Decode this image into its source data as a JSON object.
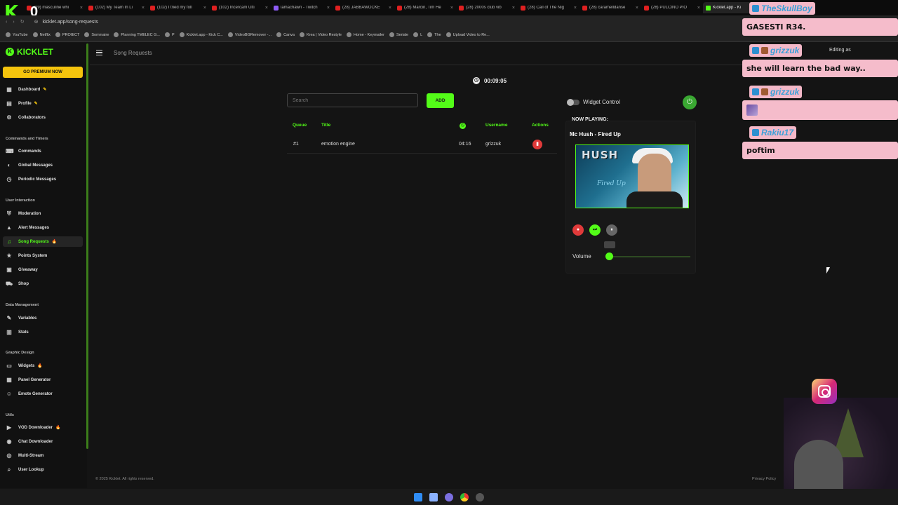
{
  "browser": {
    "tabs": [
      {
        "label": "(29) masculine whi",
        "type": "yt"
      },
      {
        "label": "(102) My Team In Li",
        "type": "yt"
      },
      {
        "label": "(102) I tried my foll",
        "type": "yt"
      },
      {
        "label": "(102) Încercăm Ulti",
        "type": "yt"
      },
      {
        "label": "lamachawn - Twitch",
        "type": "twitch"
      },
      {
        "label": "(28) JABBAWOCKE",
        "type": "yt"
      },
      {
        "label": "(28) Marcin, Tim He",
        "type": "yt"
      },
      {
        "label": "(28) 2000s club vib",
        "type": "yt"
      },
      {
        "label": "(28) Call of The Nig",
        "type": "yt"
      },
      {
        "label": "(28) caramelldanse",
        "type": "yt"
      },
      {
        "label": "(28) PULCINO PIO",
        "type": "yt"
      },
      {
        "label": "Kicklet.app - Ki",
        "type": "kick"
      }
    ],
    "url": "kicklet.app/song-requests",
    "bookmarks": [
      "YouTube",
      "Netflix",
      "PROIECT",
      "Sommaire",
      "Planning TMELEC G...",
      "P",
      "Kicklet.app - Kick C...",
      "VideoBGRemover -...",
      "Canva",
      "Krea | Video Restyle",
      "Home - Keymailer",
      "Seriale",
      "L",
      "The",
      "Upload Video to Re..."
    ]
  },
  "stream_overlay": {
    "logo": "K",
    "count": "0"
  },
  "sidebar": {
    "brand": "KICKLET",
    "premium": "GO PREMIUM NOW",
    "items_top": [
      {
        "label": "Dashboard",
        "icon": "dashboard-icon",
        "glyph": "▦",
        "badge": "✎"
      },
      {
        "label": "Profile",
        "icon": "profile-icon",
        "glyph": "▤",
        "badge": "✎"
      },
      {
        "label": "Collaborators",
        "icon": "collaborators-icon",
        "glyph": "⚙",
        "badge": ""
      }
    ],
    "sections": [
      "Commands and Timers",
      "User Interaction",
      "Data Management",
      "Graphic Design",
      "Utils"
    ],
    "commands": [
      {
        "label": "Commands",
        "glyph": "⌨"
      },
      {
        "label": "Global Messages",
        "glyph": "◐"
      },
      {
        "label": "Periodic Messages",
        "glyph": "◷"
      }
    ],
    "interaction": [
      {
        "label": "Moderation",
        "glyph": "⛨",
        "badge": ""
      },
      {
        "label": "Alert Messages",
        "glyph": "▲",
        "badge": ""
      },
      {
        "label": "Song Requests",
        "glyph": "♫",
        "badge": "🔥"
      },
      {
        "label": "Points System",
        "glyph": "★",
        "badge": ""
      },
      {
        "label": "Giveaway",
        "glyph": "▣",
        "badge": ""
      },
      {
        "label": "Shop",
        "glyph": "⛟",
        "badge": ""
      }
    ],
    "data_mgmt": [
      {
        "label": "Variables",
        "glyph": "✎"
      },
      {
        "label": "Stats",
        "glyph": "▥"
      }
    ],
    "graphic": [
      {
        "label": "Widgets",
        "glyph": "▭",
        "badge": "🔥"
      },
      {
        "label": "Panel Generator",
        "glyph": "▦",
        "badge": ""
      },
      {
        "label": "Emote Generator",
        "glyph": "☺",
        "badge": ""
      }
    ],
    "utils": [
      {
        "label": "VOD Downloader",
        "glyph": "▶",
        "badge": "🔥"
      },
      {
        "label": "Chat Downloader",
        "glyph": "◉",
        "badge": ""
      },
      {
        "label": "Multi-Stream",
        "glyph": "◎",
        "badge": ""
      },
      {
        "label": "User Lookup",
        "glyph": "⌕",
        "badge": ""
      }
    ]
  },
  "header": {
    "title": "Song Requests",
    "editing": "Editing as"
  },
  "main": {
    "timer": "00:09:05",
    "search_placeholder": "Search",
    "add_label": "ADD",
    "columns": {
      "queue": "Queue",
      "title": "Title",
      "username": "Username",
      "actions": "Actions"
    },
    "rows": [
      {
        "queue": "#1",
        "title": "emotion engine",
        "duration": "04:16",
        "username": "grizzuk"
      }
    ]
  },
  "player": {
    "widget_control": "Widget Control",
    "now_playing": "NOW PLAYING:",
    "track": "Mc Hush - Fired Up",
    "cover_title": "HUSH",
    "cover_sub": "Fired Up",
    "volume_label": "Volume",
    "volume_level": 0.0
  },
  "chat": [
    {
      "user": "TheSkullBoy",
      "message": "GASESTI R34."
    },
    {
      "user": "grizzuk",
      "message": "she will learn the bad way.."
    },
    {
      "user": "grizzuk",
      "message": ""
    },
    {
      "user": "Rakiu17",
      "message": "poftim"
    }
  ],
  "footer": {
    "copyright": "© 2025 Kicklet. All rights reserved.",
    "privacy": "Privacy Policy"
  },
  "colors": {
    "accent": "#53fc18",
    "premium": "#f5c40d",
    "danger": "#e03a3a",
    "chat_bg": "#f5bccb"
  }
}
